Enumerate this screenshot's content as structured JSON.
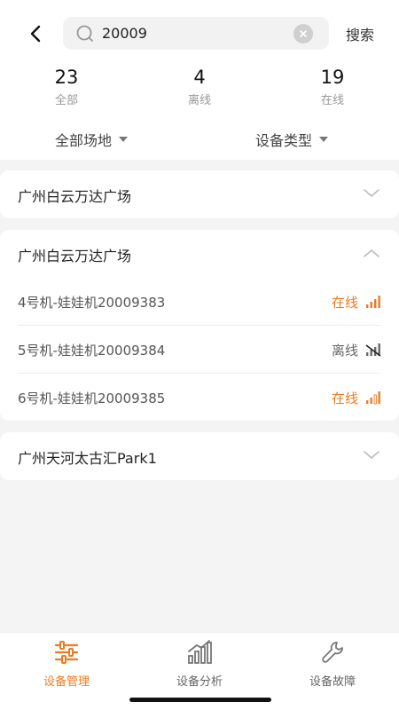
{
  "search": {
    "value": "20009",
    "button_label": "搜索"
  },
  "stats": [
    {
      "count": "23",
      "label": "全部"
    },
    {
      "count": "4",
      "label": "离线"
    },
    {
      "count": "19",
      "label": "在线"
    }
  ],
  "filters": {
    "venue": "全部场地",
    "device_type": "设备类型"
  },
  "groups": [
    {
      "title": "广州白云万达广场",
      "expanded": false
    },
    {
      "title": "广州白云万达广场",
      "expanded": true,
      "devices": [
        {
          "name": "4号机-娃娃机20009383",
          "status": "在线",
          "online": true
        },
        {
          "name": "5号机-娃娃机20009384",
          "status": "离线",
          "online": false
        },
        {
          "name": "6号机-娃娃机20009385",
          "status": "在线",
          "online": true
        }
      ]
    },
    {
      "title": "广州天河太古汇Park1",
      "expanded": false
    }
  ],
  "nav": [
    {
      "label": "设备管理",
      "icon": "sliders-icon",
      "active": true
    },
    {
      "label": "设备分析",
      "icon": "bar-chart-icon",
      "active": false
    },
    {
      "label": "设备故障",
      "icon": "wrench-icon",
      "active": false
    }
  ],
  "colors": {
    "accent": "#f07b20",
    "background": "#f4f4f4"
  }
}
